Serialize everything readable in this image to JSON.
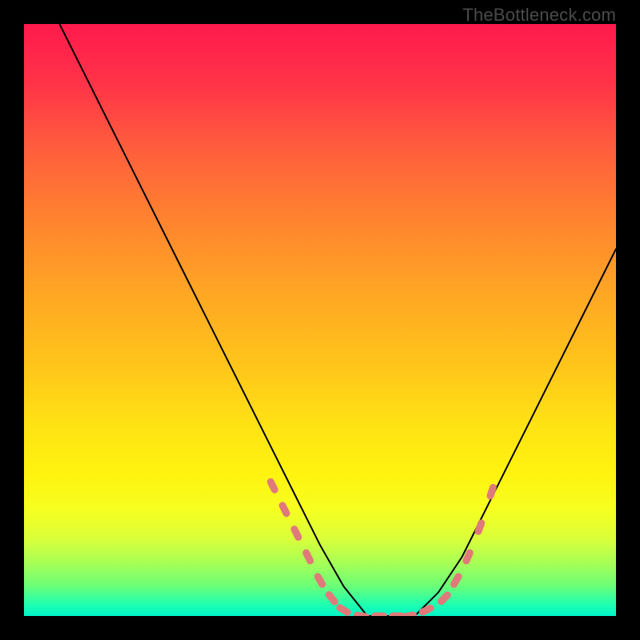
{
  "watermark": "TheBottleneck.com",
  "chart_data": {
    "type": "line",
    "title": "",
    "xlabel": "",
    "ylabel": "",
    "xlim": [
      0,
      100
    ],
    "ylim": [
      0,
      100
    ],
    "grid": false,
    "legend": false,
    "background": "gradient-red-yellow-green",
    "series": [
      {
        "name": "bottleneck-curve",
        "color": "#000000",
        "x": [
          6,
          10,
          14,
          18,
          22,
          26,
          30,
          34,
          38,
          42,
          46,
          50,
          54,
          58,
          62,
          66,
          70,
          74,
          78,
          82,
          86,
          90,
          94,
          98,
          100
        ],
        "values": [
          100,
          92,
          84,
          76,
          68,
          60,
          52,
          44,
          36,
          28,
          20,
          12,
          5,
          0,
          0,
          0,
          4,
          10,
          18,
          26,
          34,
          42,
          50,
          58,
          62
        ]
      },
      {
        "name": "flat-markers",
        "color": "#e07a7a",
        "marker": "capsule",
        "x": [
          42,
          44,
          46,
          48,
          50,
          52,
          54,
          57,
          60,
          63,
          65,
          68,
          71,
          73,
          75,
          77,
          79
        ],
        "values": [
          22,
          18,
          14,
          10,
          6,
          3,
          1,
          0,
          0,
          0,
          0,
          1,
          3,
          6,
          10,
          15,
          21
        ]
      }
    ]
  }
}
